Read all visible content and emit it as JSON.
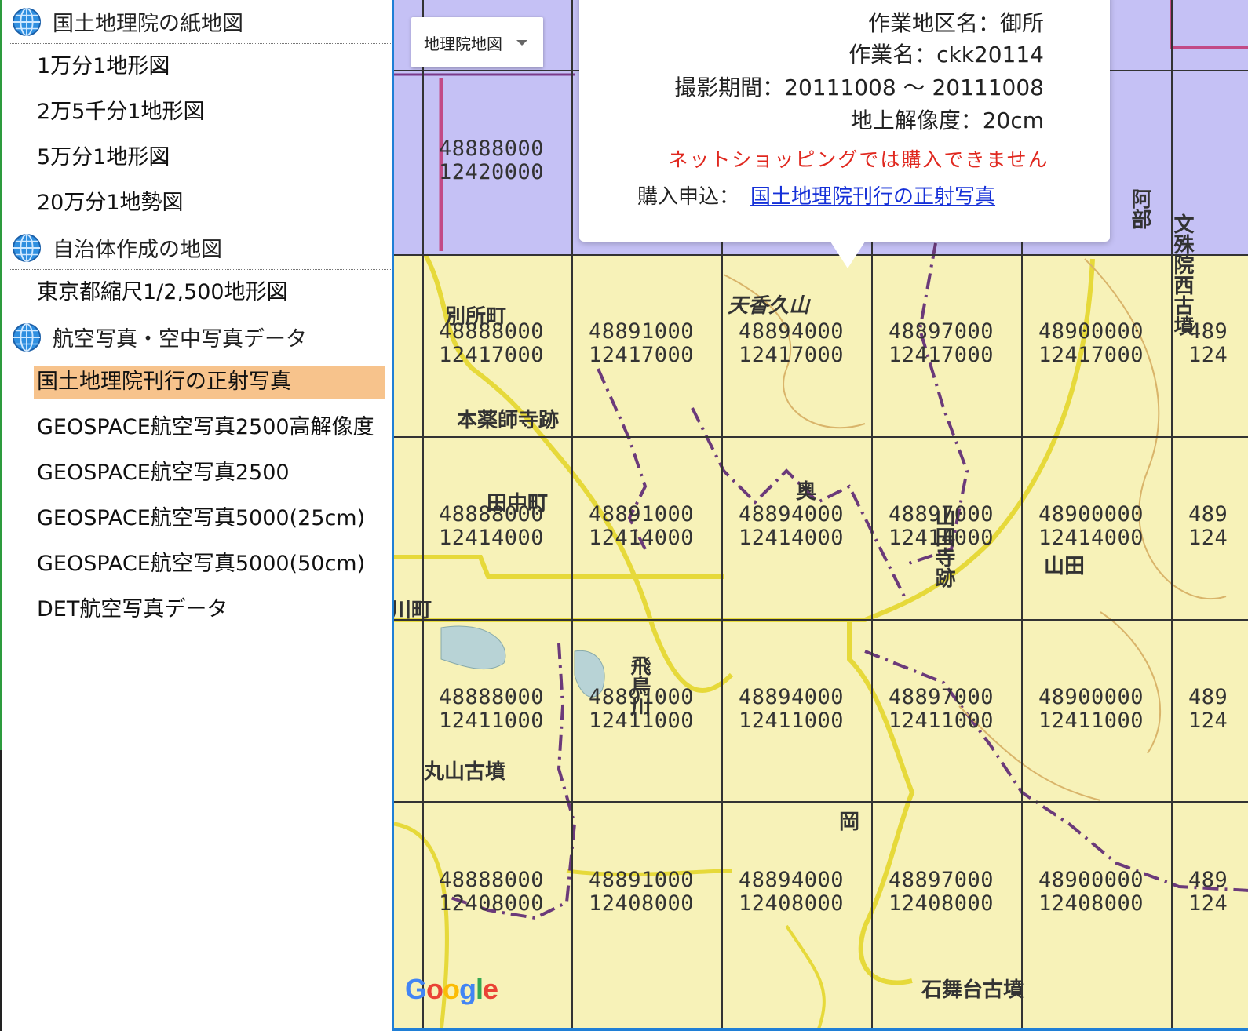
{
  "sidebar": {
    "sections": [
      {
        "title": "国土地理院の紙地図",
        "icon": "globe-icon",
        "items": [
          "1万分1地形図",
          "2万5千分1地形図",
          "5万分1地形図",
          "20万分1地勢図"
        ]
      },
      {
        "title": "自治体作成の地図",
        "icon": "globe-icon",
        "items": [
          "東京都縮尺1/2,500地形図"
        ]
      },
      {
        "title": "航空写真・空中写真データ",
        "icon": "globe-icon",
        "items": [
          "国土地理院刊行の正射写真",
          "GEOSPACE航空写真2500高解像度",
          "GEOSPACE航空写真2500",
          "GEOSPACE航空写真5000(25cm)",
          "GEOSPACE航空写真5000(50cm)",
          "DET航空写真データ"
        ]
      }
    ],
    "selected_item": "国土地理院刊行の正射写真",
    "colors": {
      "selected_bg": "#f7c38c",
      "left_accent": "#2d9b3e"
    }
  },
  "map": {
    "map_type_label": "地理院地図",
    "colors": {
      "purple_tile": "#c5c1f5",
      "yellow_tile": "#f7f2b8",
      "border": "#1f7fd6"
    },
    "grid": {
      "x_values": [
        "48888000",
        "48891000",
        "48894000",
        "48897000",
        "48900000",
        "489"
      ],
      "y_values": [
        "12420000",
        "12417000",
        "12414000",
        "12411000",
        "12408000"
      ]
    },
    "place_names": [
      "天香久山",
      "別所町",
      "本薬師寺跡",
      "田中町",
      "奥",
      "山田寺跡",
      "山田",
      "飛鳥川",
      "丸山古墳",
      "岡",
      "石舞台古墳",
      "阿部",
      "文殊院西古墳",
      "川町"
    ],
    "attribution": "Google",
    "info_window": {
      "area_name": "作業地区名：御所",
      "work_name": "作業名：ckk20114",
      "period": "撮影期間：20111008 ～ 20111008",
      "resolution": "地上解像度：20cm",
      "warning": "ネットショッピングでは購入できません",
      "purchase_label": "購入申込：",
      "purchase_link": "国土地理院刊行の正射写真"
    }
  }
}
